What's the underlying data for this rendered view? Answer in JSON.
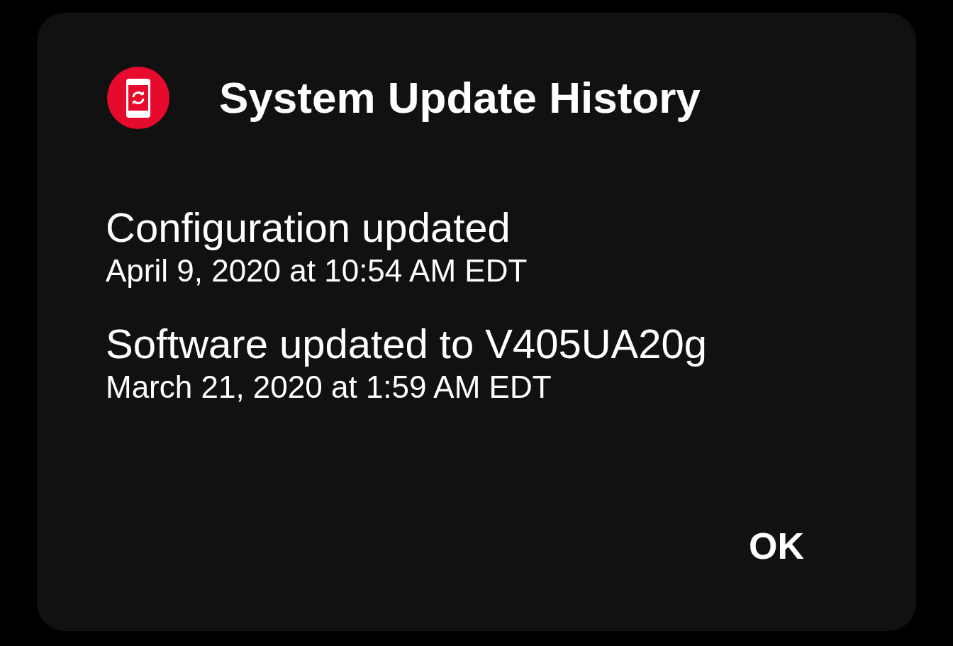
{
  "dialog": {
    "title": "System Update History",
    "entries": [
      {
        "title": "Configuration updated",
        "date": "April 9, 2020 at 10:54 AM EDT"
      },
      {
        "title": "Software updated to V405UA20g",
        "date": "March 21, 2020 at 1:59 AM EDT"
      }
    ],
    "buttons": [
      "OK"
    ]
  }
}
